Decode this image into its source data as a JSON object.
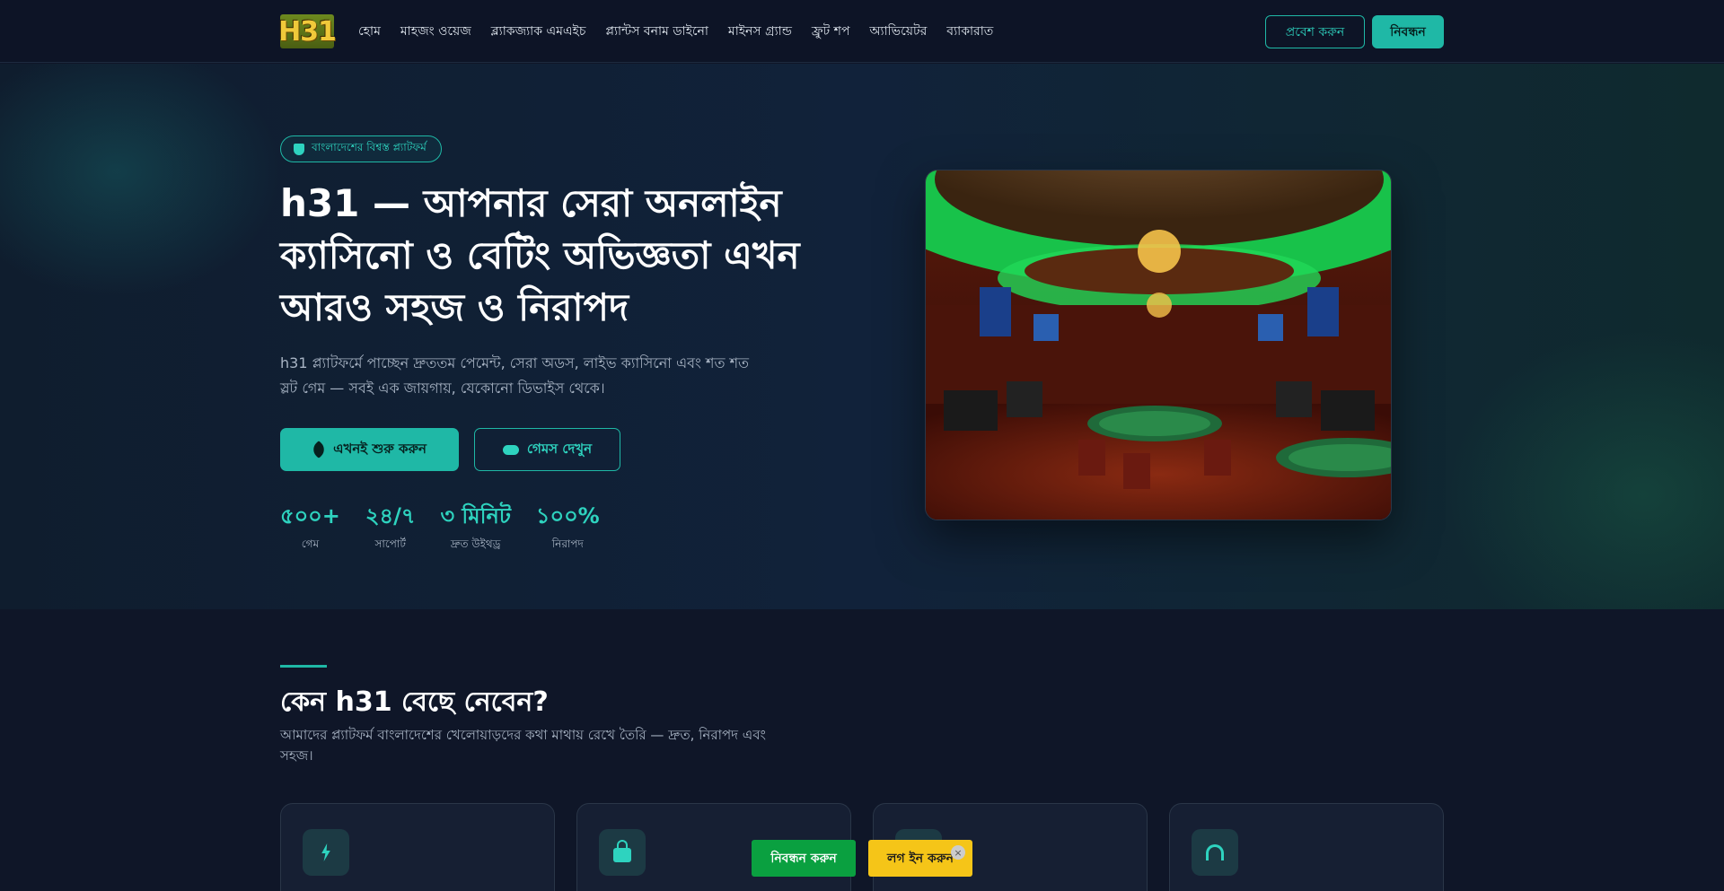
{
  "header": {
    "logo": "H31",
    "nav": [
      "হোম",
      "মাহজং ওয়েজ",
      "ব্ল্যাকজ্যাক এমএইচ",
      "প্ল্যান্টস বনাম ডাইনো",
      "মাইনস গ্র্যান্ড",
      "ফ্রুট শপ",
      "অ্যাভিয়েটর",
      "ব্যাকারাত"
    ],
    "login_label": "প্রবেশ করুন",
    "register_label": "নিবন্ধন"
  },
  "hero": {
    "badge": "বাংলাদেশের বিশ্বস্ত প্ল্যাটফর্ম",
    "title": "h31 — আপনার সেরা অনলাইন ক্যাসিনো ও বেটিং অভিজ্ঞতা এখন আরও সহজ ও নিরাপদ",
    "subtitle": "h31 প্ল্যাটফর্মে পাচ্ছেন দ্রুততম পেমেন্ট, সেরা অডস, লাইভ ক্যাসিনো এবং শত শত স্লট গেম — সবই এক জায়গায়, যেকোনো ডিভাইস থেকে।",
    "start_label": "এখনই শুরু করুন",
    "games_label": "গেমস দেখুন",
    "stats": [
      {
        "value": "৫০০+",
        "label": "গেম"
      },
      {
        "value": "২৪/৭",
        "label": "সাপোর্ট"
      },
      {
        "value": "৩ মিনিট",
        "label": "দ্রুত উইথড্র"
      },
      {
        "value": "১০০%",
        "label": "নিরাপদ"
      }
    ]
  },
  "features": {
    "title": "কেন h31 বেছে নেবেন?",
    "subtitle": "আমাদের প্ল্যাটফর্ম বাংলাদেশের খেলোয়াড়দের কথা মাথায় রেখে তৈরি — দ্রুত, নিরাপদ এবং সহজ।",
    "cards": [
      {
        "icon": "bolt-icon"
      },
      {
        "icon": "lock-icon"
      },
      {
        "icon": "shield-icon"
      },
      {
        "icon": "headset-icon"
      }
    ]
  },
  "floating": {
    "register_label": "নিবন্ধন করুন",
    "login_label": "লগ ইন করুন",
    "close": "×"
  },
  "colors": {
    "accent": "#1fb8a6",
    "background": "#0f1628",
    "register_green": "#0aa040",
    "login_yellow": "#f5c518"
  }
}
